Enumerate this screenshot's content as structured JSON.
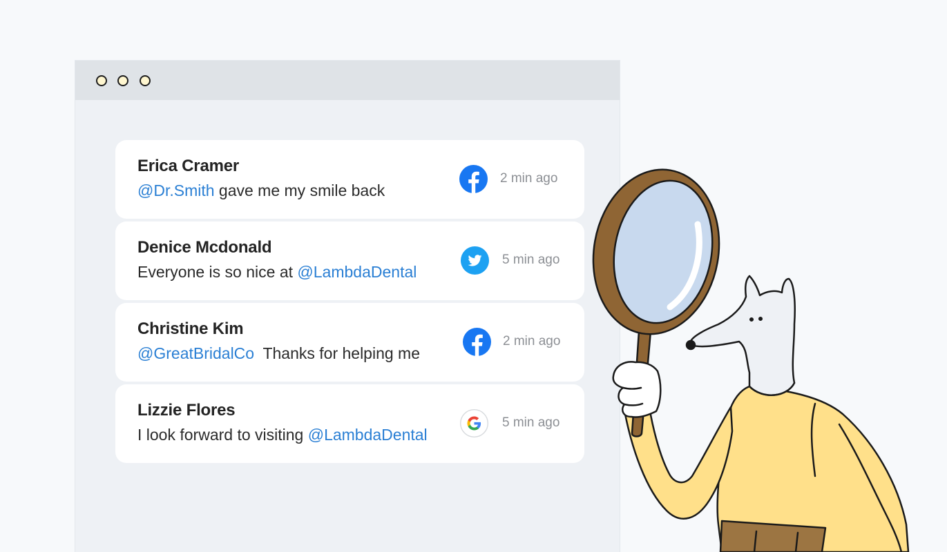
{
  "window": {
    "controls": [
      "control-dot",
      "control-dot",
      "control-dot"
    ]
  },
  "feed": {
    "items": [
      {
        "author": "Erica Cramer",
        "mention_before": "@Dr.Smith",
        "text_after": " gave me my smile back",
        "text_before": "",
        "mention_after": "",
        "source_icon": "facebook-icon",
        "time": "2 min ago"
      },
      {
        "author": "Denice Mcdonald",
        "mention_before": "",
        "text_after": "",
        "text_before": "Everyone is so nice at ",
        "mention_after": "@LambdaDental",
        "source_icon": "twitter-icon",
        "time": "5 min ago"
      },
      {
        "author": "Christine Kim",
        "mention_before": "@GreatBridalCo",
        "text_after": "  Thanks for helping me",
        "text_before": "",
        "mention_after": "",
        "source_icon": "facebook-icon",
        "time": "2 min ago"
      },
      {
        "author": "Lizzie Flores",
        "mention_before": "",
        "text_after": "",
        "text_before": "I look forward to visiting ",
        "mention_after": "@LambdaDental",
        "source_icon": "google-icon",
        "time": "5 min ago"
      }
    ]
  },
  "colors": {
    "mention": "#2a7fd4",
    "facebook": "#1877f2",
    "twitter": "#1da1f2",
    "sweater": "#ffe08a",
    "lens": "#c8d9ee",
    "magnifier_frame": "#8f6534"
  },
  "illustration": {
    "icon": "dog-with-magnifying-glass-icon"
  }
}
